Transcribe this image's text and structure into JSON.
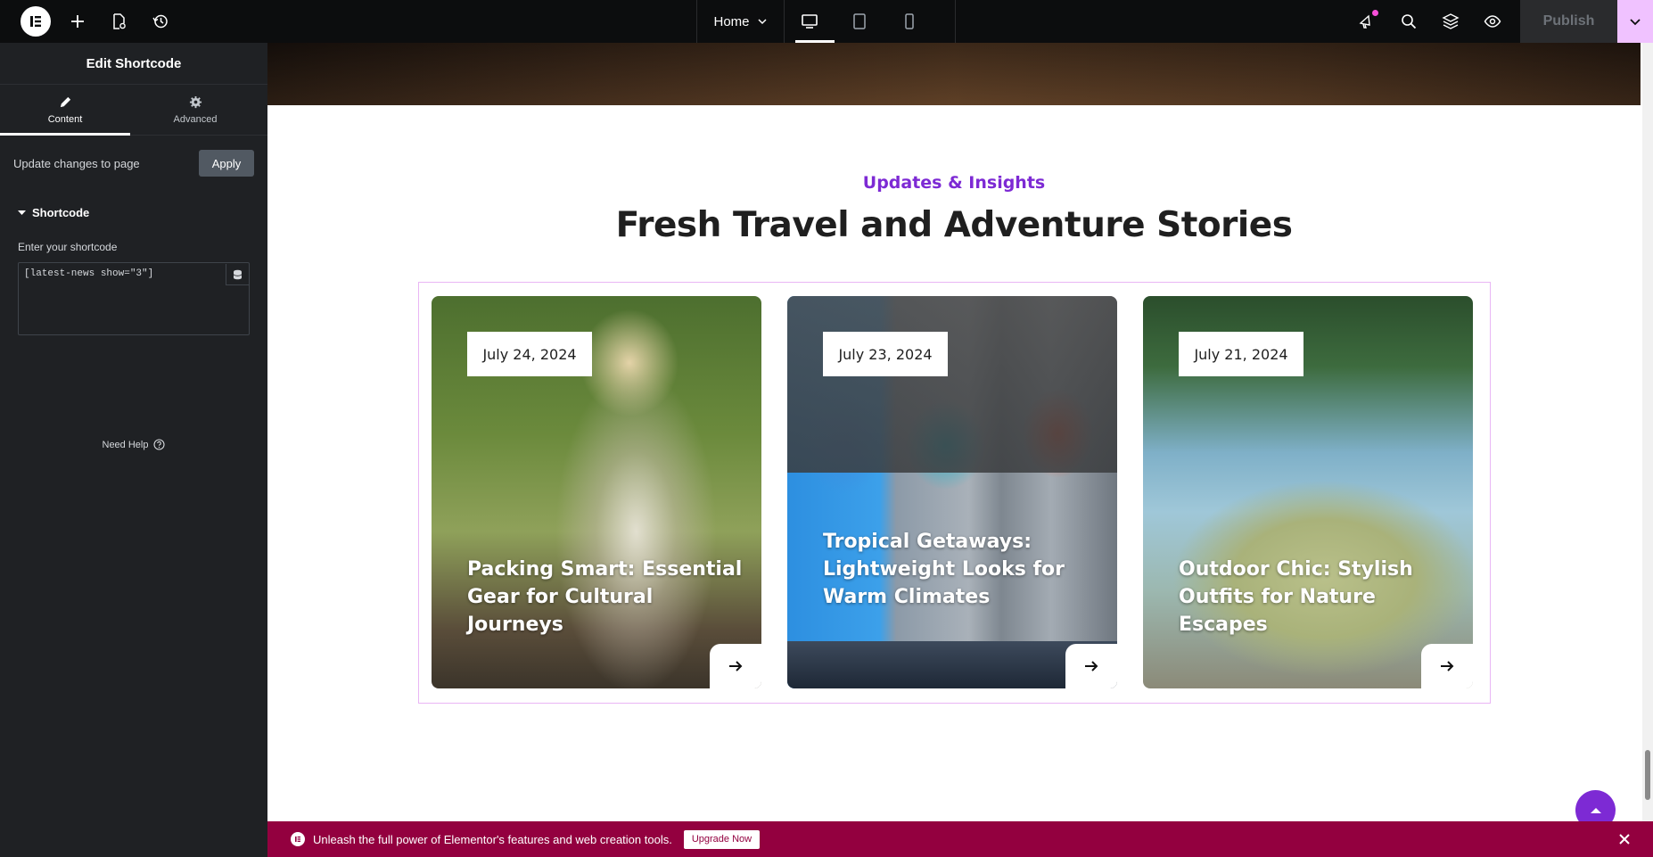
{
  "topbar": {
    "page_name": "Home",
    "publish_label": "Publish",
    "icons": [
      "elementor-logo-icon",
      "add-element-icon",
      "page-settings-icon",
      "history-icon",
      "whats-new-icon",
      "search-icon",
      "structure-icon",
      "preview-icon"
    ],
    "devices": [
      "desktop-icon",
      "tablet-icon",
      "mobile-icon"
    ],
    "active_device": "desktop"
  },
  "sidebar": {
    "title": "Edit Shortcode",
    "tabs": [
      {
        "label": "Content",
        "icon": "pencil-icon",
        "active": true
      },
      {
        "label": "Advanced",
        "icon": "gear-icon",
        "active": false
      }
    ],
    "update_text": "Update changes to page",
    "apply_label": "Apply",
    "section_title": "Shortcode",
    "field_label": "Enter your shortcode",
    "shortcode_value": "[latest-news show=\"3\"]",
    "help_label": "Need Help"
  },
  "canvas": {
    "subtitle": "Updates & Insights",
    "heading": "Fresh Travel and Adventure Stories",
    "cards": [
      {
        "date": "July 24, 2024",
        "title": "Packing Smart: Essential Gear for Cultural Journeys"
      },
      {
        "date": "July 23, 2024",
        "title": "Tropical Getaways: Lightweight Looks for Warm Climates"
      },
      {
        "date": "July 21, 2024",
        "title": "Outdoor Chic: Stylish Outfits for Nature Escapes"
      }
    ]
  },
  "promo": {
    "text": "Unleash the full power of Elementor's features and web creation tools.",
    "button_label": "Upgrade Now"
  },
  "colors": {
    "accent_purple": "#7d2ad4",
    "promo_bg": "#93003f",
    "topbar_bg": "#0c0d0e",
    "panel_bg": "#1f2124",
    "publish_dropdown": "#f0c2ff"
  }
}
